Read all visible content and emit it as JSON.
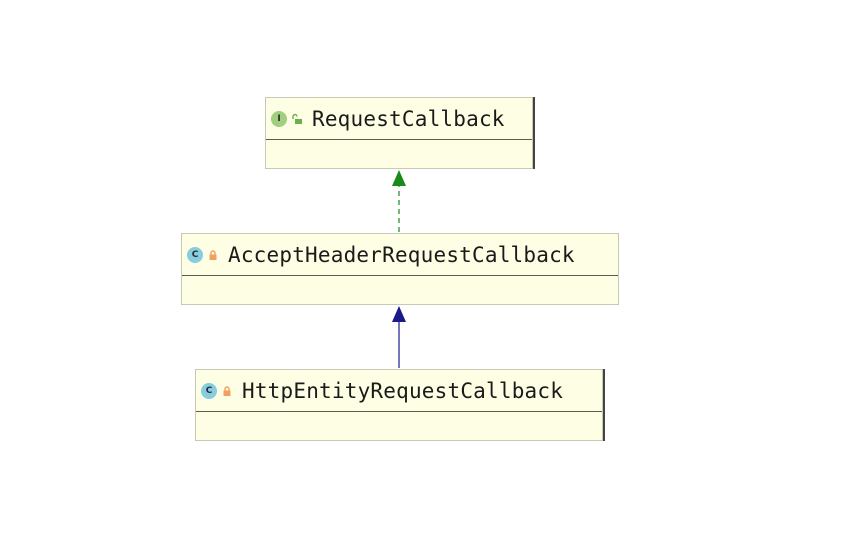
{
  "diagram": {
    "nodes": [
      {
        "id": "request-callback",
        "name": "RequestCallback",
        "kind": "interface",
        "kind_letter": "I",
        "visibility": "public",
        "badge_color": "#9fcf7f",
        "visibility_color": "#6ab04c"
      },
      {
        "id": "accept-header-request-callback",
        "name": "AcceptHeaderRequestCallback",
        "kind": "class",
        "kind_letter": "C",
        "visibility": "private",
        "badge_color": "#86cde0",
        "visibility_color": "#f0a060"
      },
      {
        "id": "http-entity-request-callback",
        "name": "HttpEntityRequestCallback",
        "kind": "class",
        "kind_letter": "C",
        "visibility": "private",
        "badge_color": "#86cde0",
        "visibility_color": "#f0a060"
      }
    ],
    "edges": [
      {
        "from": "accept-header-request-callback",
        "to": "request-callback",
        "type": "implements",
        "style": "dashed",
        "color": "#1a8a1a"
      },
      {
        "from": "http-entity-request-callback",
        "to": "accept-header-request-callback",
        "type": "extends",
        "style": "solid",
        "color": "#1a1a8a"
      }
    ]
  }
}
